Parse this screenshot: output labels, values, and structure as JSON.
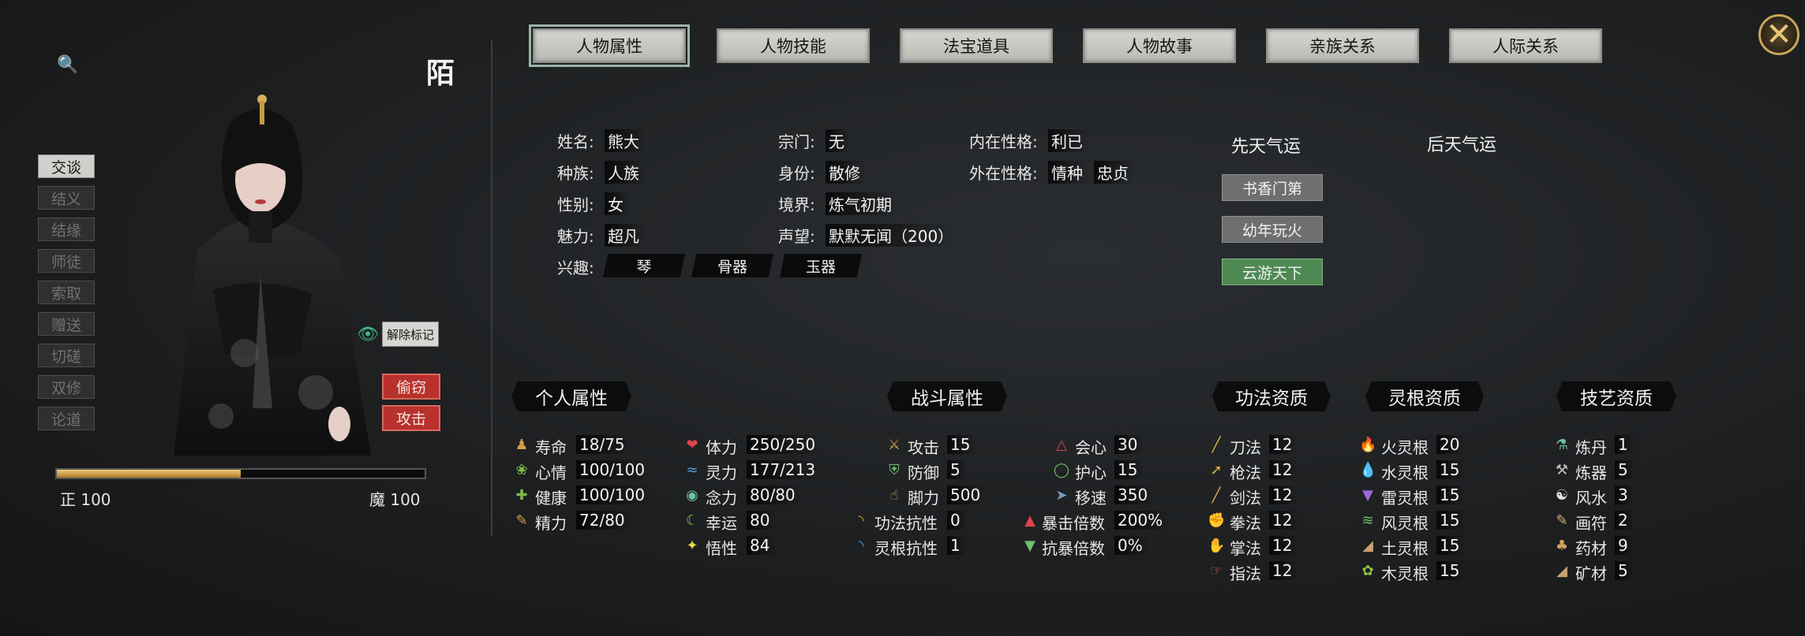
{
  "character": {
    "name": "陌",
    "righteous_label": "正 100",
    "demonic_label": "魔 100",
    "alignment_fill": 0.5
  },
  "tabs": [
    "人物属性",
    "人物技能",
    "法宝道具",
    "人物故事",
    "亲族关系",
    "人际关系"
  ],
  "actions": [
    "交谈",
    "结义",
    "结缘",
    "师徒",
    "索取",
    "赠送",
    "切磋",
    "双修",
    "论道"
  ],
  "unmark_label": "解除标记",
  "steal_label": "偷窃",
  "attack_label": "攻击",
  "info": {
    "name_label": "姓名:",
    "name_value": "熊大",
    "race_label": "种族:",
    "race_value": "人族",
    "gender_label": "性别:",
    "gender_value": "女",
    "charm_label": "魅力:",
    "charm_value": "超凡",
    "interest_label": "兴趣:",
    "interests": [
      "琴",
      "骨器",
      "玉器"
    ],
    "sect_label": "宗门:",
    "sect_value": "无",
    "identity_label": "身份:",
    "identity_value": "散修",
    "realm_label": "境界:",
    "realm_value": "炼气初期",
    "fame_label": "声望:",
    "fame_value": "默默无闻（200）",
    "inner_label": "内在性格:",
    "inner_value": "利已",
    "outer_label": "外在性格:",
    "outer_values": [
      "情种",
      "忠贞"
    ]
  },
  "fate": {
    "innate_title": "先天气运",
    "acquired_title": "后天气运",
    "innate_items": [
      "书香门第",
      "幼年玩火",
      "云游天下"
    ]
  },
  "sections": {
    "personal": "个人属性",
    "combat": "战斗属性",
    "technique": "功法资质",
    "root": "灵根资质",
    "craft": "技艺资质"
  },
  "personal_col1": [
    {
      "label": "寿命",
      "value": "18/75"
    },
    {
      "label": "心情",
      "value": "100/100"
    },
    {
      "label": "健康",
      "value": "100/100"
    },
    {
      "label": "精力",
      "value": "72/80"
    }
  ],
  "personal_col2": [
    {
      "label": "体力",
      "value": "250/250"
    },
    {
      "label": "灵力",
      "value": "177/213"
    },
    {
      "label": "念力",
      "value": "80/80"
    },
    {
      "label": "幸运",
      "value": "80"
    },
    {
      "label": "悟性",
      "value": "84"
    }
  ],
  "combat_col1": [
    {
      "label": "攻击",
      "value": "15"
    },
    {
      "label": "防御",
      "value": "5"
    },
    {
      "label": "脚力",
      "value": "500"
    },
    {
      "label": "功法抗性",
      "value": "0"
    },
    {
      "label": "灵根抗性",
      "value": "1"
    }
  ],
  "combat_col2": [
    {
      "label": "会心",
      "value": "30"
    },
    {
      "label": "护心",
      "value": "15"
    },
    {
      "label": "移速",
      "value": "350"
    },
    {
      "label": "暴击倍数",
      "value": "200%"
    },
    {
      "label": "抗暴倍数",
      "value": "0%"
    }
  ],
  "technique": [
    {
      "label": "刀法",
      "value": "12"
    },
    {
      "label": "枪法",
      "value": "12"
    },
    {
      "label": "剑法",
      "value": "12"
    },
    {
      "label": "拳法",
      "value": "12"
    },
    {
      "label": "掌法",
      "value": "12"
    },
    {
      "label": "指法",
      "value": "12"
    }
  ],
  "root": [
    {
      "label": "火灵根",
      "value": "20"
    },
    {
      "label": "水灵根",
      "value": "15"
    },
    {
      "label": "雷灵根",
      "value": "15"
    },
    {
      "label": "风灵根",
      "value": "15"
    },
    {
      "label": "土灵根",
      "value": "15"
    },
    {
      "label": "木灵根",
      "value": "15"
    }
  ],
  "craft": [
    {
      "label": "炼丹",
      "value": "1"
    },
    {
      "label": "炼器",
      "value": "5"
    },
    {
      "label": "风水",
      "value": "3"
    },
    {
      "label": "画符",
      "value": "2"
    },
    {
      "label": "药材",
      "value": "9"
    },
    {
      "label": "矿材",
      "value": "5"
    }
  ],
  "icons": {
    "search": "search-icon",
    "close": "close-icon",
    "eye": "eye-icon"
  }
}
